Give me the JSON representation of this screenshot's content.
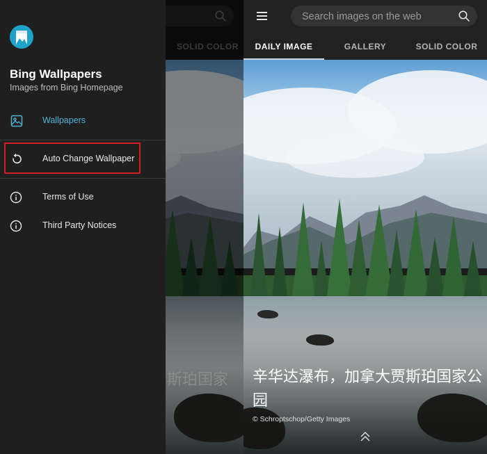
{
  "search": {
    "placeholder": "Search images on the web"
  },
  "tabs": [
    {
      "label": "DAILY IMAGE",
      "active": true
    },
    {
      "label": "GALLERY",
      "active": false
    },
    {
      "label": "SOLID COLOR",
      "active": false
    }
  ],
  "photo": {
    "caption": "辛华达瀑布，加拿大贾斯珀国家公园",
    "caption_partial_behind": "斯珀国家",
    "credit": "© Schroptschop/Getty Images"
  },
  "drawer": {
    "app_title": "Bing Wallpapers",
    "app_subtitle": "Images from Bing Homepage",
    "items": [
      {
        "label": "Wallpapers",
        "icon": "image-icon",
        "active": true
      },
      {
        "label": "Auto Change Wallpaper",
        "icon": "refresh-icon",
        "highlighted": true
      },
      {
        "label": "Terms of Use",
        "icon": "info-icon"
      },
      {
        "label": "Third Party Notices",
        "icon": "info-icon"
      }
    ]
  },
  "colors": {
    "accent": "#4fb3d9",
    "drawer_bg": "#1f1f1f",
    "highlight_box": "#d11f24",
    "logo_bg": "#1fa3c8"
  }
}
